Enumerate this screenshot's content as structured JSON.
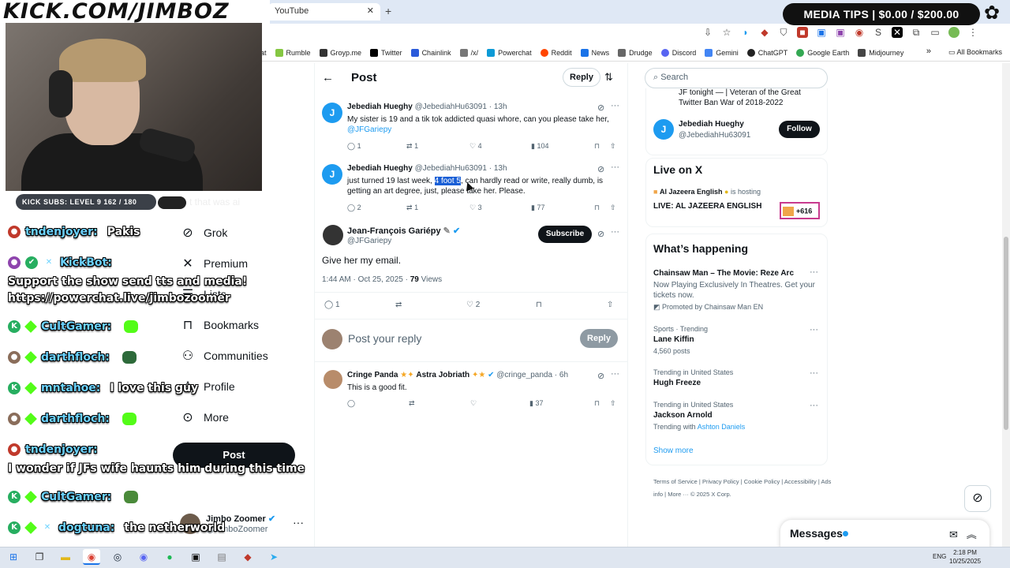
{
  "browser": {
    "tab_title": "YouTube",
    "bookmarks": [
      {
        "label": "at",
        "color": "#555555"
      },
      {
        "label": "Rumble",
        "color": "#85c742"
      },
      {
        "label": "Groyp.me",
        "color": "#333333"
      },
      {
        "label": "Twitter",
        "color": "#000000"
      },
      {
        "label": "Chainlink",
        "color": "#2a5ada"
      },
      {
        "label": "/x/",
        "color": "#777777"
      },
      {
        "label": "Powerchat",
        "color": "#0d9ad6"
      },
      {
        "label": "Reddit",
        "color": "#ff4500"
      },
      {
        "label": "News",
        "color": "#1a73e8"
      },
      {
        "label": "Drudge",
        "color": "#666666"
      },
      {
        "label": "Discord",
        "color": "#5865f2"
      },
      {
        "label": "Gemini",
        "color": "#4285f4"
      },
      {
        "label": "ChatGPT",
        "color": "#222222"
      },
      {
        "label": "Google Earth",
        "color": "#34a853"
      },
      {
        "label": "Midjourney",
        "color": "#444444"
      }
    ],
    "all_bookmarks": "All Bookmarks"
  },
  "overlay": {
    "brand": "KICK.COM/JIMBOZ",
    "subs": "KICK SUBS: LEVEL 9 162 / 180",
    "subs_text": "t that was ai",
    "media_tips": "MEDIA TIPS | $0.00 / $200.00"
  },
  "chat": [
    {
      "user": "tndenjoyer:",
      "msg": "Pakis",
      "avatar_color": "#c0392b"
    },
    {
      "user": "KickBot:",
      "msg": "",
      "avatar_color": "#8e44ad"
    },
    {
      "user": "",
      "msg": "Support the show send tts and media!",
      "avatar_color": ""
    },
    {
      "user": "",
      "msg": "https://powerchat.live/jimbozoomer",
      "avatar_color": ""
    },
    {
      "user": "CultGamer:",
      "msg": "",
      "avatar_color": "#27ae60"
    },
    {
      "user": "darthfloch:",
      "msg": "",
      "avatar_color": "#8a6d5a"
    },
    {
      "user": "mntahoe:",
      "msg": "I love this guy",
      "avatar_color": "#27ae60"
    },
    {
      "user": "darthfloch:",
      "msg": "",
      "avatar_color": "#8a6d5a"
    },
    {
      "user": "tndenjoyer:",
      "msg": "",
      "avatar_color": "#c0392b"
    },
    {
      "user": "",
      "msg": "I wonder if JFs wife haunts him during this time",
      "avatar_color": ""
    },
    {
      "user": "CultGamer:",
      "msg": "",
      "avatar_color": "#27ae60"
    },
    {
      "user": "dogtuna:",
      "msg": "the netherworld",
      "avatar_color": "#27ae60"
    }
  ],
  "nav": {
    "grok": "Grok",
    "premium": "Premium",
    "lists": "Lists",
    "bookmarks": "Bookmarks",
    "communities": "Communities",
    "profile": "Profile",
    "more": "More",
    "post": "Post"
  },
  "account": {
    "name": "Jimbo Zoomer",
    "handle": "@JimboZoomer"
  },
  "post_header": {
    "title": "Post",
    "reply": "Reply"
  },
  "replies_above": [
    {
      "name": "Jebediah Hueghy",
      "handle": "@JebediahHu63091",
      "time": "13h",
      "text": "My sister is 19 and a tik tok addicted quasi whore, can you please take her,",
      "mention": "@JFGariepy",
      "replies": "1",
      "reposts": "1",
      "likes": "4",
      "views": "104"
    },
    {
      "name": "Jebediah Hueghy",
      "handle": "@JebediahHu63091",
      "time": "13h",
      "text_before": "just turned 19 last week,",
      "text_highlight": "4 foot 5",
      "text_after": ", can hardly read or write, really dumb, is getting an art degree, just, please take her. Please.",
      "replies": "2",
      "reposts": "1",
      "likes": "3",
      "views": "77"
    }
  ],
  "main_post": {
    "name": "Jean-François Gariépy",
    "handle": "@JFGariepy",
    "subscribe": "Subscribe",
    "text": "Give her my email.",
    "time": "1:44 AM · Oct 25, 2025 ·",
    "views_count": "79",
    "views_label": "Views",
    "replies": "1",
    "likes": "2"
  },
  "reply_box": {
    "placeholder": "Post your reply",
    "button": "Reply"
  },
  "reply_below": {
    "name": "Cringe Panda",
    "name_extra": "Astra Jobriath",
    "handle": "@cringe_panda",
    "time": "6h",
    "text": "This is a good fit.",
    "views": "37"
  },
  "right": {
    "search_placeholder": "Search",
    "top_snippet": "JF tonight — | Veteran of the Great Twitter Ban War of 2018-2022",
    "follow_name": "Jebediah Hueghy",
    "follow_handle": "@JebediahHu63091",
    "follow_button": "Follow",
    "live_title": "Live on X",
    "live_host": "Al Jazeera English",
    "live_host_suffix": "is hosting",
    "live_name": "LIVE: AL JAZEERA ENGLISH",
    "live_count": "+616",
    "trend_title": "What’s happening",
    "trends": [
      {
        "meta": "",
        "name": "Chainsaw Man – The Movie: Reze Arc",
        "desc": "Now Playing Exclusively In Theatres. Get your tickets now.",
        "extra": "Promoted by Chainsaw Man EN"
      },
      {
        "meta": "Sports · Trending",
        "name": "Lane Kiffin",
        "desc": "4,560 posts",
        "extra": ""
      },
      {
        "meta": "Trending in United States",
        "name": "Hugh Freeze",
        "desc": "",
        "extra": ""
      },
      {
        "meta": "Trending in United States",
        "name": "Jackson Arnold",
        "desc": "Trending with",
        "extra": "Ashton Daniels"
      }
    ],
    "show_more": "Show more",
    "footer": "Terms of Service  |  Privacy Policy  |  Cookie Policy  |  Accessibility  |  Ads info  |  More ···  © 2025 X Corp.",
    "messages": "Messages"
  },
  "taskbar": {
    "lang": "ENG",
    "time": "2:18 PM",
    "date": "10/25/2025"
  }
}
